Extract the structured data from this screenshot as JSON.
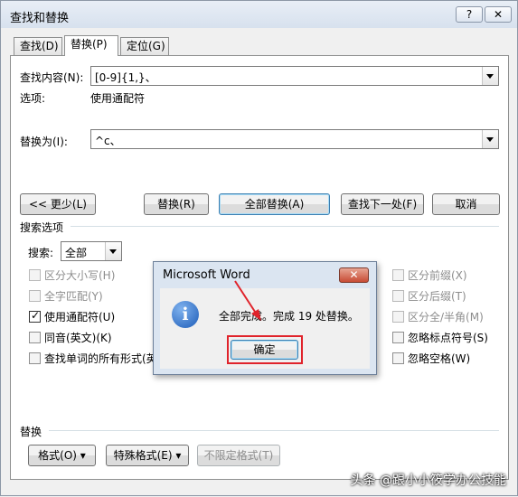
{
  "window": {
    "title": "查找和替换",
    "help_label": "?",
    "close_label": "✕"
  },
  "tabs": [
    {
      "label": "查找(D)",
      "active": false
    },
    {
      "label": "替换(P)",
      "active": true
    },
    {
      "label": "定位(G)",
      "active": false
    }
  ],
  "find": {
    "label": "查找内容(N):",
    "value": "[0-9]{1,}、",
    "options_label": "选项:",
    "options_value": "使用通配符"
  },
  "replace": {
    "label": "替换为(I):",
    "value": "^c、"
  },
  "buttons": {
    "less": "<< 更少(L)",
    "replace": "替换(R)",
    "replace_all": "全部替换(A)",
    "find_next": "查找下一处(F)",
    "cancel": "取消"
  },
  "search_options": {
    "section_label": "搜索选项",
    "search_label": "搜索:",
    "search_value": "全部",
    "left": [
      {
        "label": "区分大小写(H)",
        "checked": false,
        "enabled": false
      },
      {
        "label": "全字匹配(Y)",
        "checked": false,
        "enabled": false
      },
      {
        "label": "使用通配符(U)",
        "checked": true,
        "enabled": true
      },
      {
        "label": "同音(英文)(K)",
        "checked": false,
        "enabled": true
      },
      {
        "label": "查找单词的所有形式(英",
        "checked": false,
        "enabled": true
      }
    ],
    "right": [
      {
        "label": "区分前缀(X)",
        "checked": false,
        "enabled": false
      },
      {
        "label": "区分后缀(T)",
        "checked": false,
        "enabled": false
      },
      {
        "label": "区分全/半角(M)",
        "checked": false,
        "enabled": false
      },
      {
        "label": "忽略标点符号(S)",
        "checked": false,
        "enabled": true
      },
      {
        "label": "忽略空格(W)",
        "checked": false,
        "enabled": true
      }
    ]
  },
  "replace_section": {
    "label": "替换",
    "format": "格式(O) ▾",
    "special": "特殊格式(E) ▾",
    "no_format": "不限定格式(T)"
  },
  "message_box": {
    "title": "Microsoft Word",
    "text": "全部完成。完成 19 处替换。",
    "ok": "确定",
    "close": "✕",
    "icon": "info-icon"
  },
  "watermark": "头条 @跟小小筱学办公技能",
  "colors": {
    "annotation": "#e0232b",
    "dialog_bg": "#f0f0f0"
  }
}
